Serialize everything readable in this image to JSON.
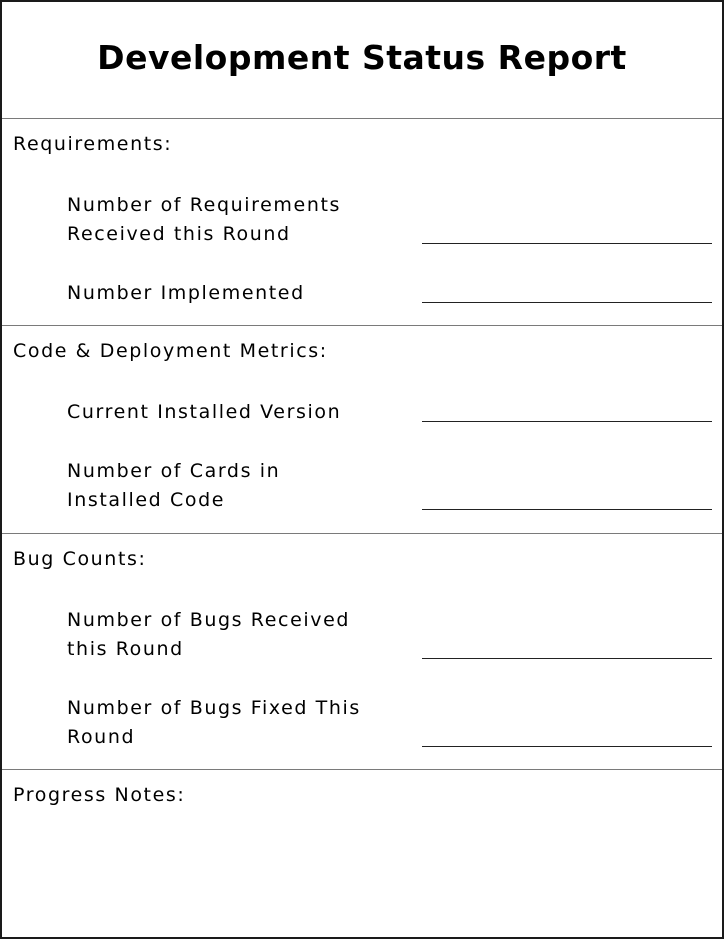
{
  "title": "Development Status Report",
  "sections": [
    {
      "heading": "Requirements:",
      "fields": [
        {
          "label": "Number of Requirements\nReceived this Round",
          "value": ""
        },
        {
          "label": "Number Implemented",
          "value": ""
        }
      ]
    },
    {
      "heading": "Code & Deployment Metrics:",
      "fields": [
        {
          "label": "Current Installed Version",
          "value": ""
        },
        {
          "label": "Number of Cards in\nInstalled Code",
          "value": ""
        }
      ]
    },
    {
      "heading": "Bug Counts:",
      "fields": [
        {
          "label": "Number of Bugs Received\nthis Round",
          "value": ""
        },
        {
          "label": "Number of Bugs Fixed This\nRound",
          "value": ""
        }
      ]
    },
    {
      "heading": "Progress Notes:",
      "fields": []
    }
  ]
}
